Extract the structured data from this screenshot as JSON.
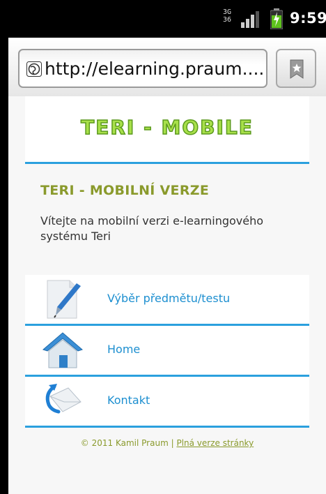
{
  "status_bar": {
    "network_label_top": "3G",
    "network_label_bottom": "36",
    "time": "9:59",
    "icons": [
      "network-type-icon",
      "signal-icon",
      "battery-charging-icon"
    ]
  },
  "browser": {
    "url": "http://elearning.praum....",
    "icons": [
      "globe-icon",
      "bookmark-icon"
    ]
  },
  "header": {
    "logo_text": "TERI - MOBILE"
  },
  "intro": {
    "title": "TERI - MOBILNÍ VERZE",
    "text": "Vítejte na mobilní verzi e-learningového systému Teri"
  },
  "menu": {
    "items": [
      {
        "label": "Výběr předmětu/testu",
        "icon": "pen-icon"
      },
      {
        "label": "Home",
        "icon": "home-icon"
      },
      {
        "label": "Kontakt",
        "icon": "mail-icon"
      }
    ]
  },
  "footer": {
    "copyright": "© 2011 Kamil Praum |",
    "link": "Plná verze stránky"
  },
  "colors": {
    "accent_blue": "#2ba0de",
    "title_olive": "#8a9a2c",
    "logo_green": "#a8e04a"
  }
}
